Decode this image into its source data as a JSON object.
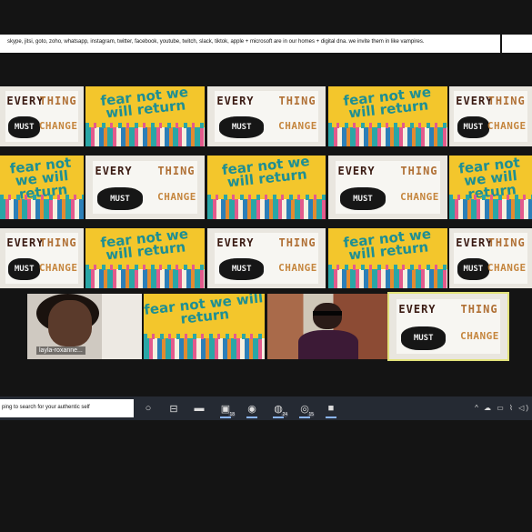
{
  "top_bar": {
    "text": "skype, jitsi, goto, zoho, whatsapp, instagram, twitter, facebook, youtube, twitch, slack, tiktok, apple + microsoft are in our homes + digital dna. we invite them in like vampires."
  },
  "posters": {
    "fear_text": "fear not we will return",
    "every": "EVERY",
    "thing": "THING",
    "must": "MUST",
    "change": "CHANGE"
  },
  "participants": [
    {
      "name": "layla-roxanne..."
    }
  ],
  "taskbar": {
    "search_text": "ping to search for your authentic self",
    "icons": [
      {
        "name": "cortana",
        "glyph": "○"
      },
      {
        "name": "task-view",
        "glyph": "⊟"
      },
      {
        "name": "file-explorer",
        "glyph": "▬"
      },
      {
        "name": "video",
        "glyph": "▣",
        "badge": "18"
      },
      {
        "name": "chrome",
        "glyph": "◉"
      },
      {
        "name": "whatsapp",
        "glyph": "◍",
        "badge": "24"
      },
      {
        "name": "app-red",
        "glyph": "◎",
        "badge": "15"
      },
      {
        "name": "zoom",
        "glyph": "■"
      }
    ],
    "tray": "^ ☁ ▭ ⌇ ◁)"
  },
  "colors": {
    "background": "#141414",
    "poster_yellow": "#f3c62c",
    "teal": "#1e8f93",
    "active_speaker": "#e2e27a",
    "taskbar": "#252a33"
  }
}
